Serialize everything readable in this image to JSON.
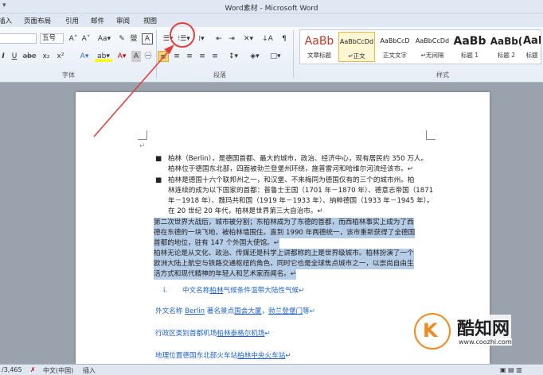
{
  "window": {
    "title": "Word素材 - Microsoft Word",
    "qa_glyph": "▾"
  },
  "menu": {
    "insert": "插入",
    "layout": "页面布局",
    "references": "引用",
    "mailings": "邮件",
    "review": "审阅",
    "view": "视图"
  },
  "ribbon": {
    "font_size": "五号",
    "groups": {
      "font": "字体",
      "paragraph": "段落",
      "styles": "样式"
    },
    "buttons": {
      "grow": "A˄",
      "shrink": "A˅",
      "change_case": "Aa▾",
      "clear_format": "✎",
      "phonetic": "燮",
      "border": "A",
      "bullets": "☰▾",
      "numbering": "⁝☰▾",
      "multilevel": "⁞▾",
      "dec_indent": "⇤",
      "inc_indent": "⇥",
      "chinese_layout": "✕▾",
      "sort": "↓A",
      "show_marks": "¶",
      "italic": "I",
      "underline": "U",
      "strike": "abe",
      "subscript": "x₂",
      "superscript": "x²",
      "effects": "A▾",
      "highlight": "ab▾",
      "font_color": "A▾",
      "char_shade": "A",
      "enclosed": "㊀",
      "align_left": "≡",
      "align_center": "≡",
      "align_right": "≡",
      "justify": "≡",
      "distribute": "≡",
      "line_spacing": "↕▾",
      "shading": "◈▾",
      "borders": "□▾"
    },
    "styles": [
      {
        "preview": "AaBb",
        "name": "文章标题"
      },
      {
        "preview": "AaBbCcDd",
        "name": "↵正文"
      },
      {
        "preview": "AaBbCcD",
        "name": "正文文字"
      },
      {
        "preview": "AaBbCcDd",
        "name": "↵无间隔"
      },
      {
        "preview": "AaBb",
        "name": "标题 1"
      },
      {
        "preview": "AaBb(",
        "name": "标题 2"
      },
      {
        "preview": "AaBb",
        "name": "标题"
      }
    ]
  },
  "doc": {
    "para1": [
      "柏林（Berlin），是德国首都、最大的城市，政治、经济中心，现有居民约 350 万人。",
      "柏林位于德国东北部，四面被勃兰登堡州环绕，施普雷河和哈维尔河流经该市。↵"
    ],
    "para2": [
      "柏林是德国十六个联邦州之一，和汉堡、不来梅同为德国仅有的三个的城市州。柏",
      "林连续的成为以下国家的首都：普鲁士王国（1701 年－1870 年）、德意志帝国（1871",
      "年－1918 年）、魏玛共和国（1919 年－1933 年）、纳粹德国（1933 年－1945 年）。",
      "在 20 世纪 20 年代，柏林是世界第三大自治市。↵"
    ],
    "hl1": [
      "第二次世界大战后，城市被分割；东柏林成为了东德的首都，而西柏林事实上成为了西",
      "德在东德的一块飞地，被柏林墙围住。直到 1990 年两德统一，该市重新获得了全德国",
      "首都的地位，驻有 147 个外国大使馆。↵"
    ],
    "hl2": [
      "柏林无论是从文化、政治、传媒还是科学上讲都称的上是世界级城市。柏林扮演了一个",
      "欧洲大陆上航空与铁路交通枢纽的角色，同时它也是全球焦点城市之一，以崇尚自由生",
      "活方式和现代精神的年轻人和艺术家而闻名。↵"
    ],
    "list_num": "i.",
    "link1": {
      "pre": "中文名称",
      "l1": "柏林",
      "post": "气候条件温带大陆性气候↵"
    },
    "link2": {
      "pre": "外文名称 ",
      "l1": "Berlin",
      "mid": " 著名景点",
      "l2": "国会大厦",
      "sep": "，",
      "l3": "勃兰登堡门",
      "post": "等↵"
    },
    "link3": {
      "pre": "行政区类别首都机场",
      "l1": "柏林泰格尔机场",
      "post": "↵"
    },
    "link4": {
      "pre": "地理位置德国东北部火车站",
      "l1": "柏林中央火车站",
      "post": "↵"
    },
    "bullet": "■",
    "para_mark": "↵"
  },
  "status": {
    "words": "/3,465",
    "lang": "中文(中国)",
    "mode": "插入"
  },
  "watermark": {
    "logo_letter": "K",
    "name": "酷知网",
    "url": "www.coozhi.com"
  },
  "colors": {
    "annotation": "#e04040",
    "link": "#1f62c7",
    "highlight": "#b6cde8"
  }
}
